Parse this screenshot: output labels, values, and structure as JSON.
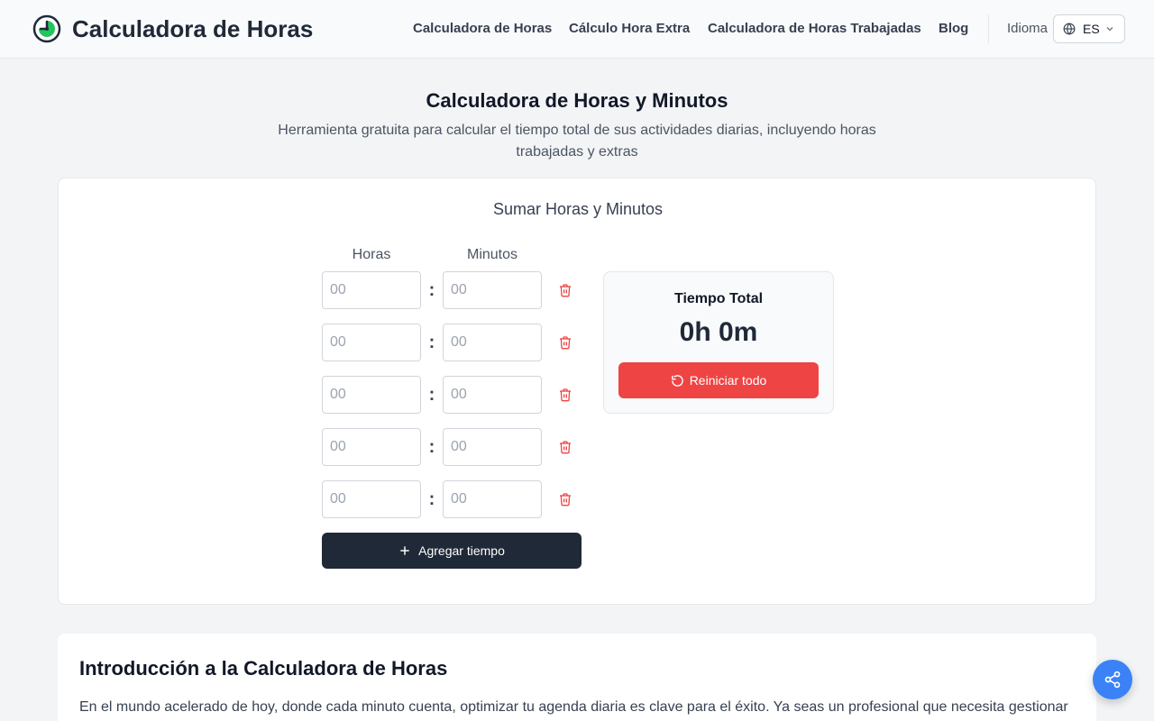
{
  "header": {
    "brand": "Calculadora de Horas",
    "nav": [
      {
        "label": "Calculadora de Horas"
      },
      {
        "label": "Cálculo Hora Extra"
      },
      {
        "label": "Calculadora de Horas Trabajadas"
      },
      {
        "label": "Blog"
      }
    ],
    "language_label": "Idioma",
    "language_code": "ES"
  },
  "hero": {
    "title": "Calculadora de Horas y Minutos",
    "subtitle": "Herramienta gratuita para calcular el tiempo total de sus actividades diarias, incluyendo horas trabajadas y extras"
  },
  "calculator": {
    "title": "Sumar Horas y Minutos",
    "hours_label": "Horas",
    "minutes_label": "Minutos",
    "rows": [
      {
        "hours_placeholder": "00",
        "minutes_placeholder": "00"
      },
      {
        "hours_placeholder": "00",
        "minutes_placeholder": "00"
      },
      {
        "hours_placeholder": "00",
        "minutes_placeholder": "00"
      },
      {
        "hours_placeholder": "00",
        "minutes_placeholder": "00"
      },
      {
        "hours_placeholder": "00",
        "minutes_placeholder": "00"
      }
    ],
    "separator": ":",
    "add_label": "Agregar tiempo",
    "total_label": "Tiempo Total",
    "total_value": "0h 0m",
    "reset_label": "Reiniciar todo"
  },
  "intro": {
    "title": "Introducción a la Calculadora de Horas",
    "text": "En el mundo acelerado de hoy, donde cada minuto cuenta, optimizar tu agenda diaria es clave para el éxito. Ya seas un profesional que necesita gestionar"
  },
  "colors": {
    "brand_green": "#22c55e",
    "danger": "#ef4444",
    "dark": "#1f2937",
    "share_blue": "#3b82f6"
  },
  "icons": [
    "clock-logo-icon",
    "globe-icon",
    "chevron-down-icon",
    "trash-icon",
    "plus-icon",
    "reset-icon",
    "share-icon"
  ]
}
